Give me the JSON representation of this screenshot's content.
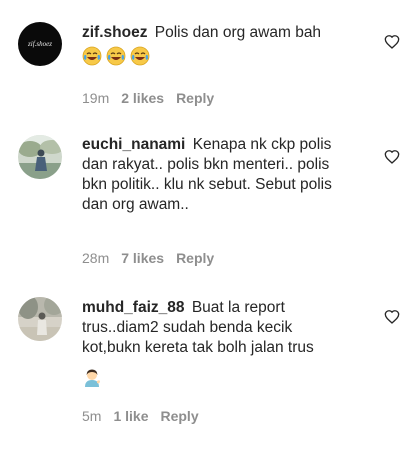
{
  "comments": [
    {
      "username": "zif.shoez",
      "avatar_text": "zif.shoez",
      "text": "Polis dan org awam bah",
      "emojis": [
        "face-with-tears-of-joy",
        "face-with-tears-of-joy",
        "face-with-tears-of-joy"
      ],
      "time": "19m",
      "likes": "2 likes",
      "reply": "Reply"
    },
    {
      "username": "euchi_nanami",
      "text_lines": [
        "Kenapa nk ckp polis",
        "dan rakyat.. polis bkn menteri.. polis",
        "bkn politik.. klu nk sebut. Sebut polis",
        "dan org awam.."
      ],
      "time": "28m",
      "likes": "7 likes",
      "reply": "Reply"
    },
    {
      "username": "muhd_faiz_88",
      "text_lines": [
        "Buat la report",
        "trus..diam2 sudah benda kecik",
        "kot,bukn kereta tak bolh jalan trus"
      ],
      "emoji": "woman-tipping-hand",
      "time": "5m",
      "likes": "1 like",
      "reply": "Reply"
    }
  ],
  "colors": {
    "text": "#262626",
    "muted": "#8e8e8e",
    "background": "#ffffff"
  }
}
